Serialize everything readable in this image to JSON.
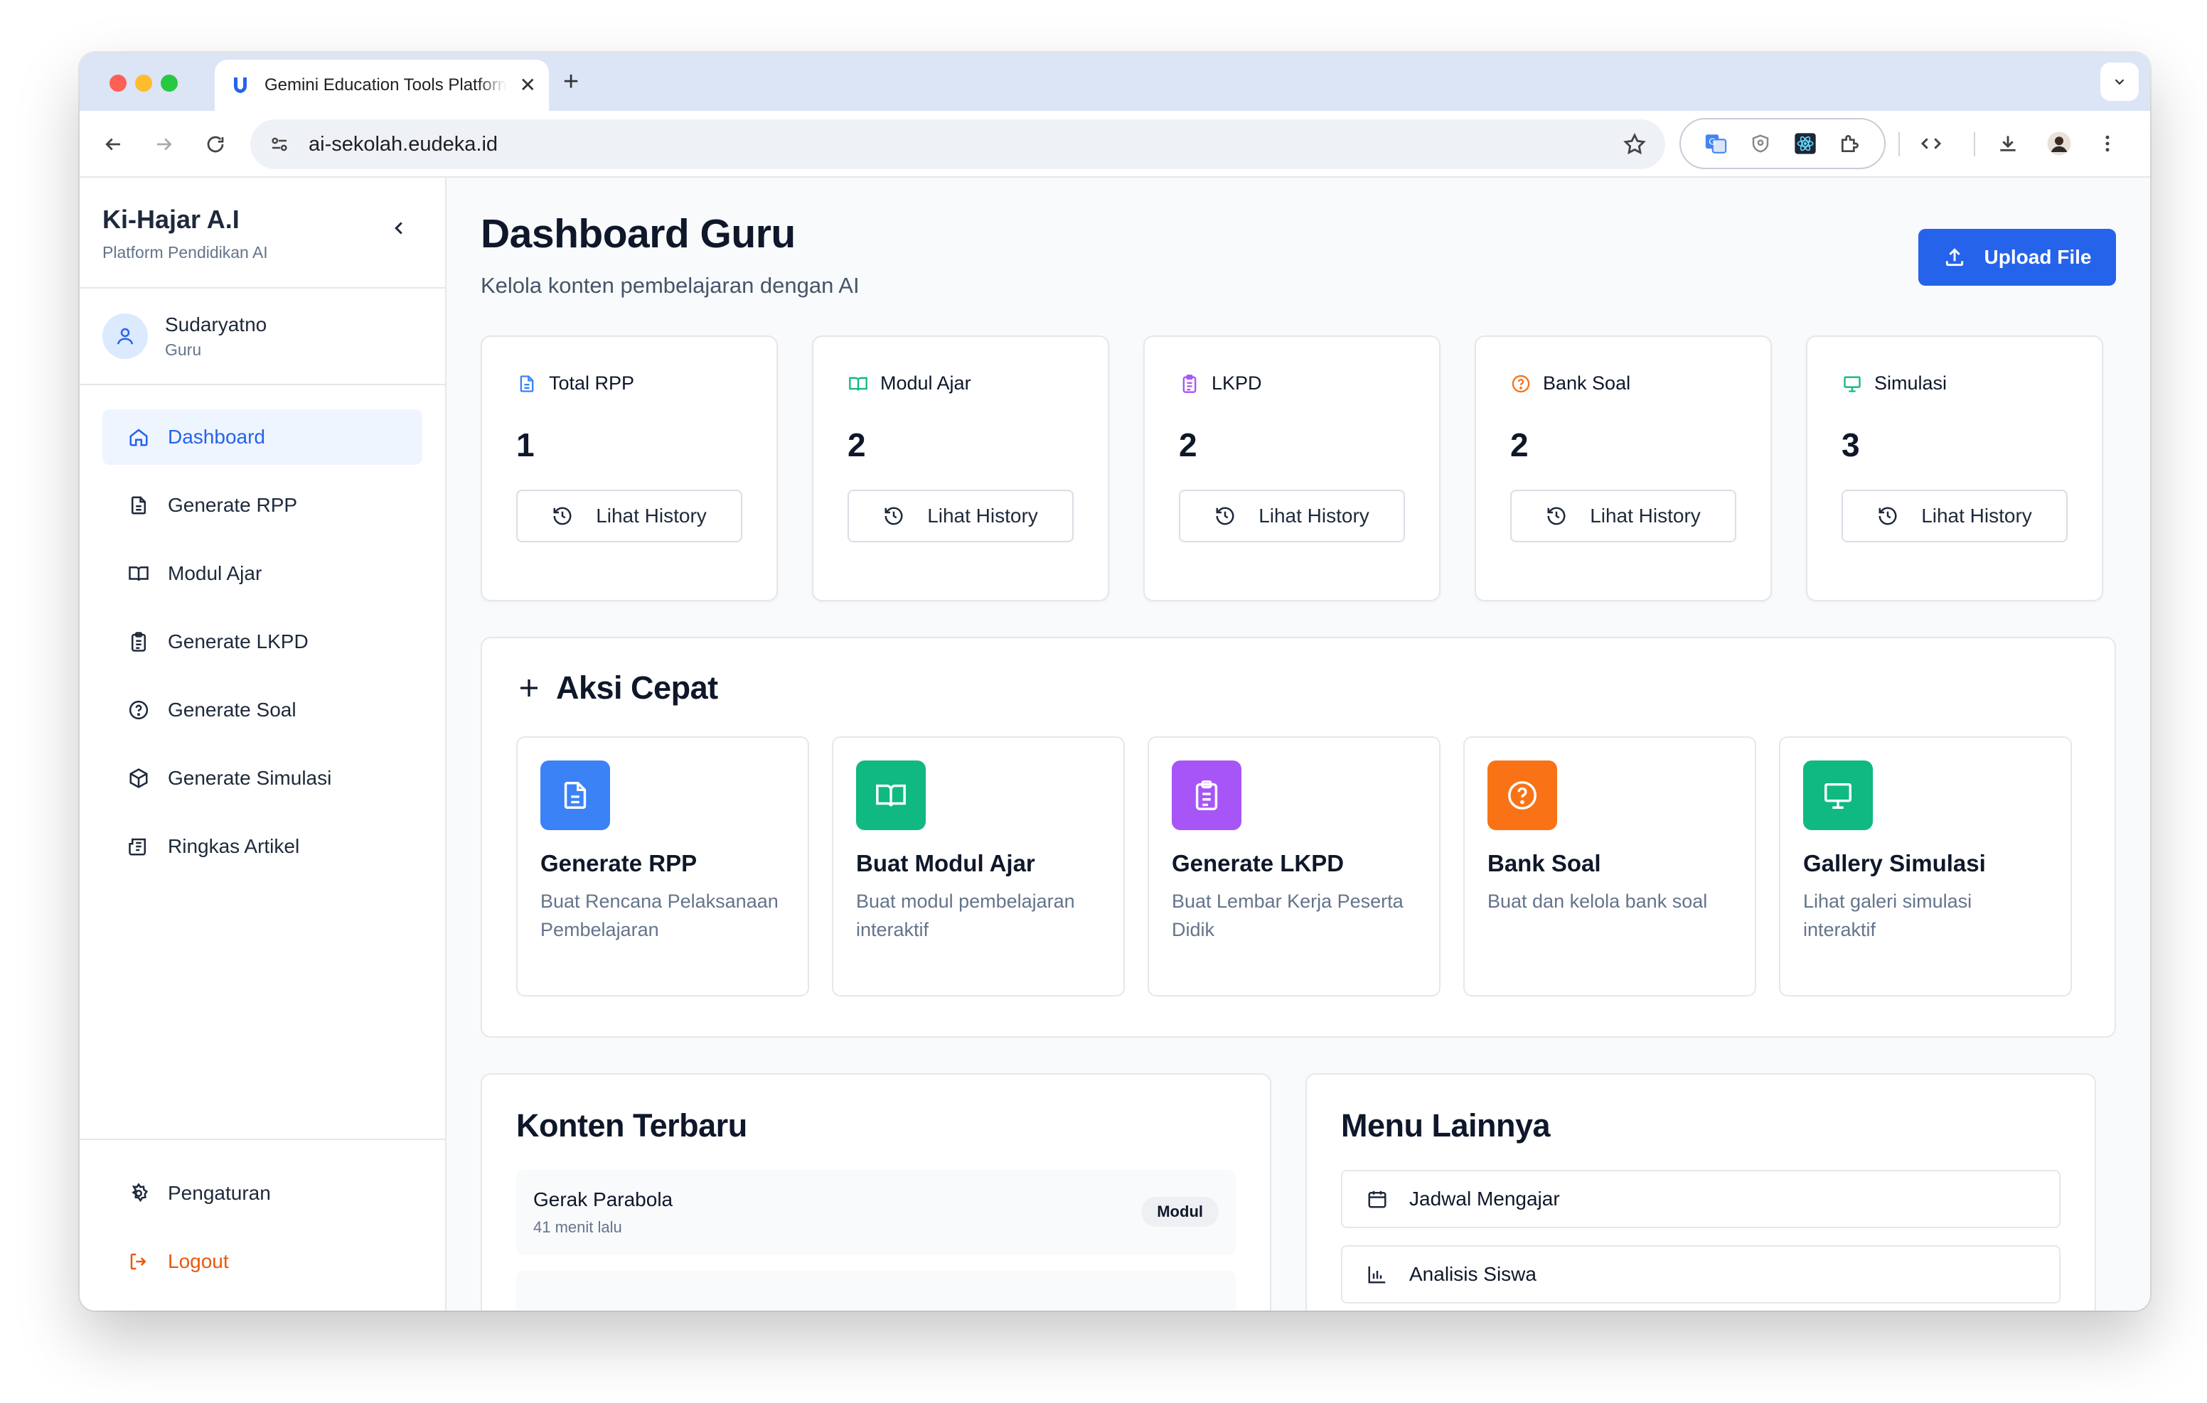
{
  "browser": {
    "tab_title": "Gemini Education Tools Platform",
    "url": "ai-sekolah.eudeka.id"
  },
  "sidebar": {
    "brand_title": "Ki-Hajar A.I",
    "brand_subtitle": "Platform Pendidikan AI",
    "user_name": "Sudaryatno",
    "user_role": "Guru",
    "items": [
      {
        "label": "Dashboard",
        "icon": "home-icon",
        "active": true
      },
      {
        "label": "Generate RPP",
        "icon": "document-icon"
      },
      {
        "label": "Modul Ajar",
        "icon": "book-icon"
      },
      {
        "label": "Generate LKPD",
        "icon": "clipboard-icon"
      },
      {
        "label": "Generate Soal",
        "icon": "question-circle-icon"
      },
      {
        "label": "Generate Simulasi",
        "icon": "cube-icon"
      },
      {
        "label": "Ringkas Artikel",
        "icon": "newspaper-icon"
      }
    ],
    "settings_label": "Pengaturan",
    "logout_label": "Logout"
  },
  "header": {
    "title": "Dashboard Guru",
    "subtitle": "Kelola konten pembelajaran dengan AI",
    "upload_label": "Upload File"
  },
  "stats": [
    {
      "label": "Total RPP",
      "value": "1",
      "history_label": "Lihat History",
      "icon": "document-icon",
      "color": "#3b82f6"
    },
    {
      "label": "Modul Ajar",
      "value": "2",
      "history_label": "Lihat History",
      "icon": "book-icon",
      "color": "#10b981"
    },
    {
      "label": "LKPD",
      "value": "2",
      "history_label": "Lihat History",
      "icon": "clipboard-icon",
      "color": "#a855f7"
    },
    {
      "label": "Bank Soal",
      "value": "2",
      "history_label": "Lihat History",
      "icon": "question-circle-icon",
      "color": "#f97316"
    },
    {
      "label": "Simulasi",
      "value": "3",
      "history_label": "Lihat History",
      "icon": "presentation-icon",
      "color": "#10b981"
    }
  ],
  "quick_actions": {
    "title": "Aksi Cepat",
    "items": [
      {
        "title": "Generate RPP",
        "desc": "Buat Rencana Pelaksanaan Pembelajaran",
        "color": "#3b82f6",
        "icon": "document-icon"
      },
      {
        "title": "Buat Modul Ajar",
        "desc": "Buat modul pembelajaran interaktif",
        "color": "#10b981",
        "icon": "book-icon"
      },
      {
        "title": "Generate LKPD",
        "desc": "Buat Lembar Kerja Peserta Didik",
        "color": "#a855f7",
        "icon": "clipboard-icon"
      },
      {
        "title": "Bank Soal",
        "desc": "Buat dan kelola bank soal",
        "color": "#f97316",
        "icon": "question-circle-icon"
      },
      {
        "title": "Gallery Simulasi",
        "desc": "Lihat galeri simulasi interaktif",
        "color": "#10b981",
        "icon": "presentation-icon"
      }
    ]
  },
  "recent": {
    "title": "Konten Terbaru",
    "items": [
      {
        "title": "Gerak Parabola",
        "time": "41 menit lalu",
        "badge": "Modul"
      }
    ]
  },
  "more_menu": {
    "title": "Menu Lainnya",
    "items": [
      {
        "label": "Jadwal Mengajar",
        "icon": "calendar-icon"
      },
      {
        "label": "Analisis Siswa",
        "icon": "bar-chart-icon"
      }
    ]
  }
}
